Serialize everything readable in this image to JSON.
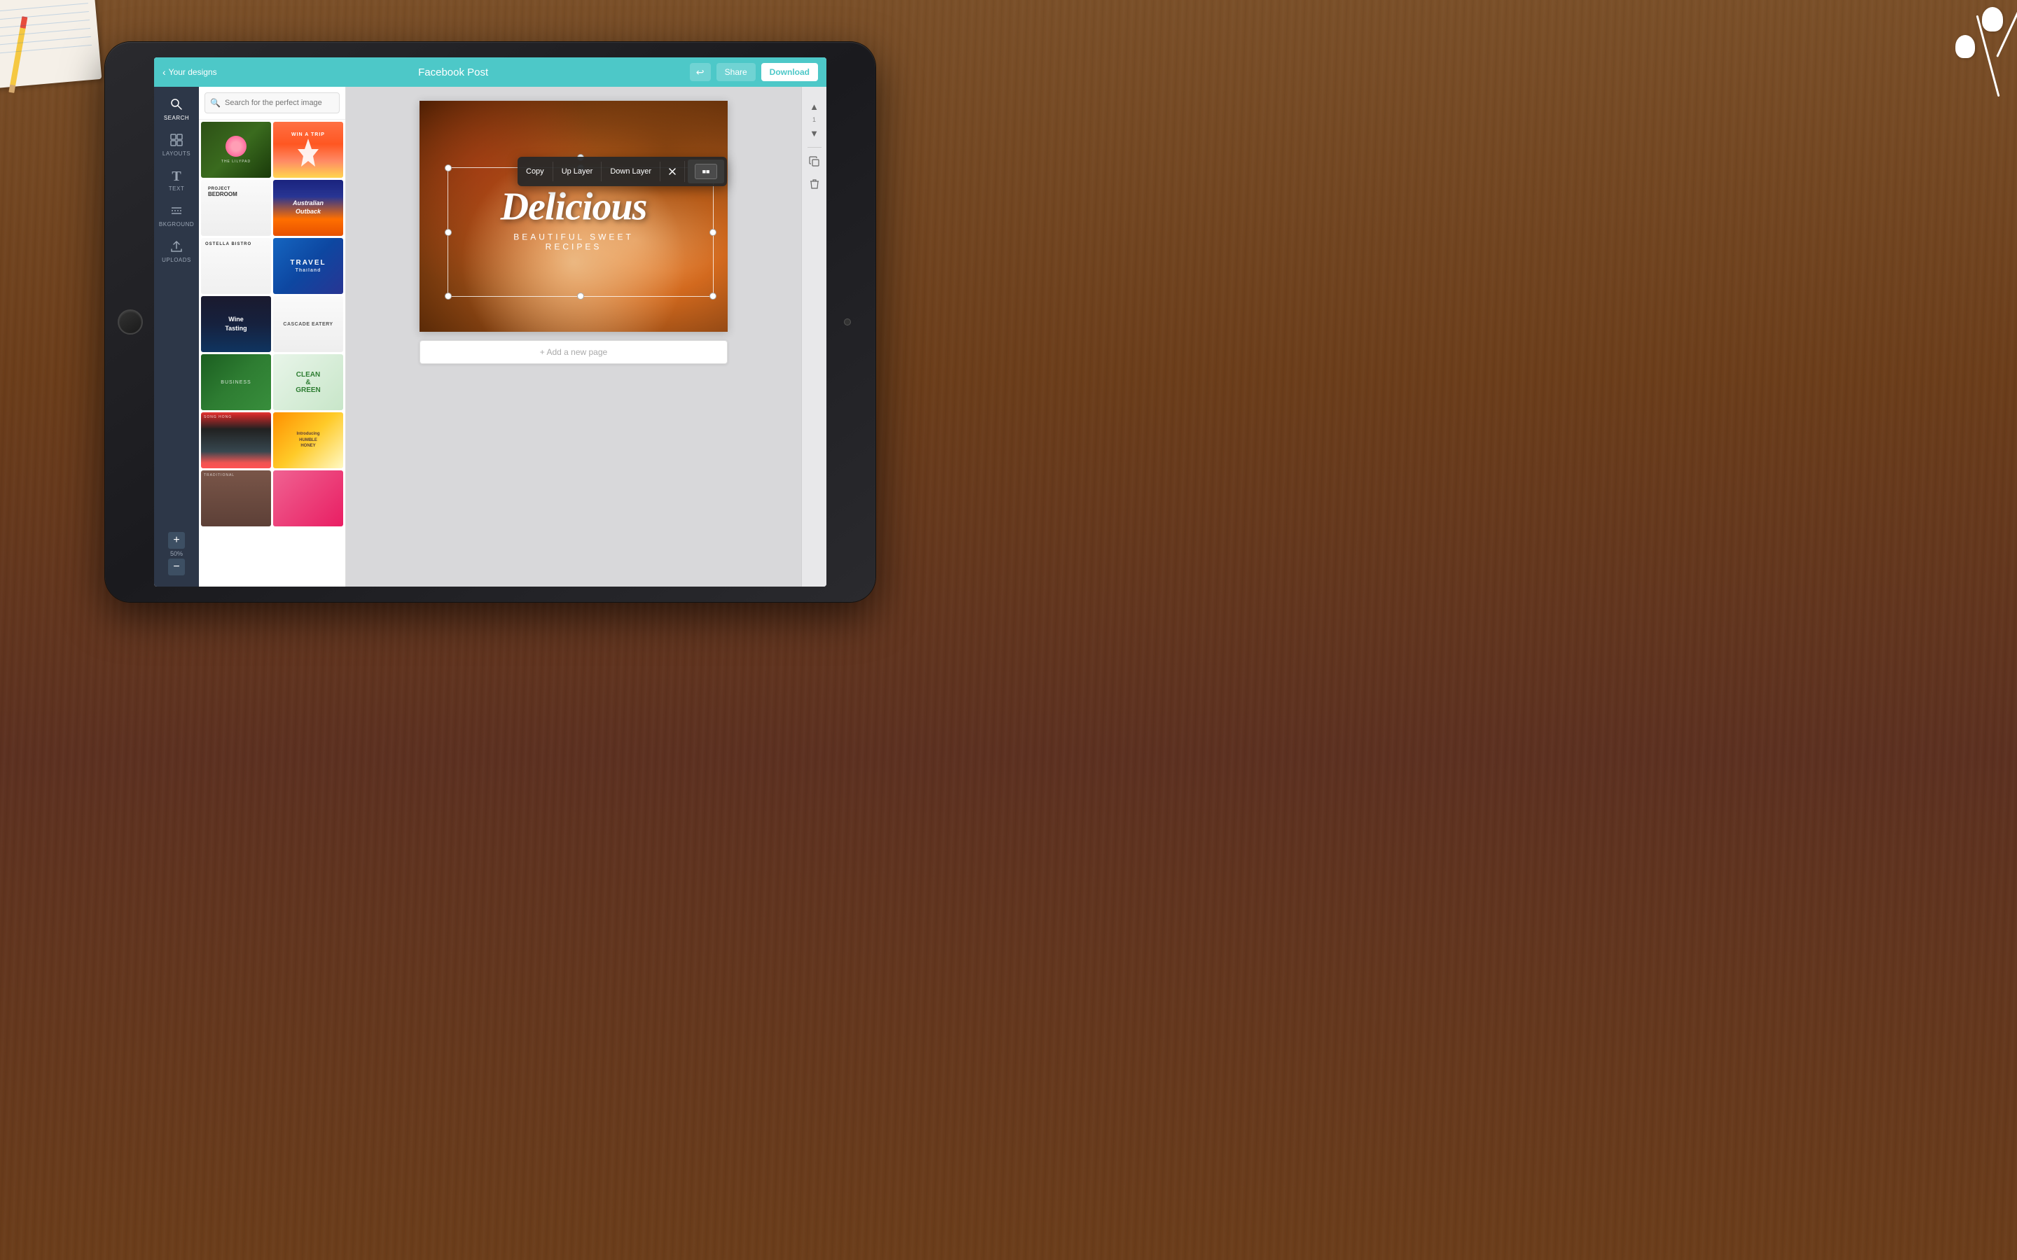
{
  "app": {
    "title": "Facebook Post",
    "back_label": "Your designs",
    "undo_icon": "↩",
    "share_label": "Share",
    "download_label": "Download"
  },
  "sidebar": {
    "items": [
      {
        "id": "search",
        "label": "SEARCH",
        "icon": "🔍"
      },
      {
        "id": "layouts",
        "label": "LAYOUTS",
        "icon": "⊞"
      },
      {
        "id": "text",
        "label": "TEXT",
        "icon": "T"
      },
      {
        "id": "background",
        "label": "BKGROUND",
        "icon": "≡"
      },
      {
        "id": "uploads",
        "label": "UPLOADS",
        "icon": "↑"
      }
    ],
    "zoom_plus": "+",
    "zoom_value": "50%",
    "zoom_minus": "−"
  },
  "search": {
    "placeholder": "Search for the perfect image"
  },
  "templates": [
    {
      "id": "lilypad",
      "label": "THE LILYPAD"
    },
    {
      "id": "paris",
      "label": "WIN A TRIP"
    },
    {
      "id": "bedroom",
      "label": "PROJECT BEDROOM"
    },
    {
      "id": "outback",
      "label": "Australian Outback"
    },
    {
      "id": "ostella",
      "label": "OSTELLA BISTRO"
    },
    {
      "id": "travel",
      "label": "TRAVEL Thailand"
    },
    {
      "id": "wine",
      "label": "Wine Tasting"
    },
    {
      "id": "cascade",
      "label": "CASCADE EATERY"
    },
    {
      "id": "business",
      "label": "BUSINESS"
    },
    {
      "id": "clean",
      "label": "CLEAN & GREEN"
    },
    {
      "id": "city",
      "label": "SONG HONG"
    },
    {
      "id": "honey",
      "label": "Introducing HUMBLE HONEY"
    },
    {
      "id": "traditional",
      "label": "TRADITIONAL"
    },
    {
      "id": "pink",
      "label": ""
    }
  ],
  "canvas": {
    "main_text": "Delicious",
    "sub_text": "BEAUTIFUL SWEET RECIPES"
  },
  "context_menu": {
    "copy": "Copy",
    "up_layer": "Up Layer",
    "down_layer": "Down Layer",
    "opacity_value": "■■"
  },
  "right_toolbar": {
    "up_arrow": "▲",
    "layer_num": "1",
    "down_arrow": "▼",
    "copy_icon": "⧉",
    "trash_icon": "🗑"
  },
  "add_page": {
    "label": "+ Add a new page"
  }
}
